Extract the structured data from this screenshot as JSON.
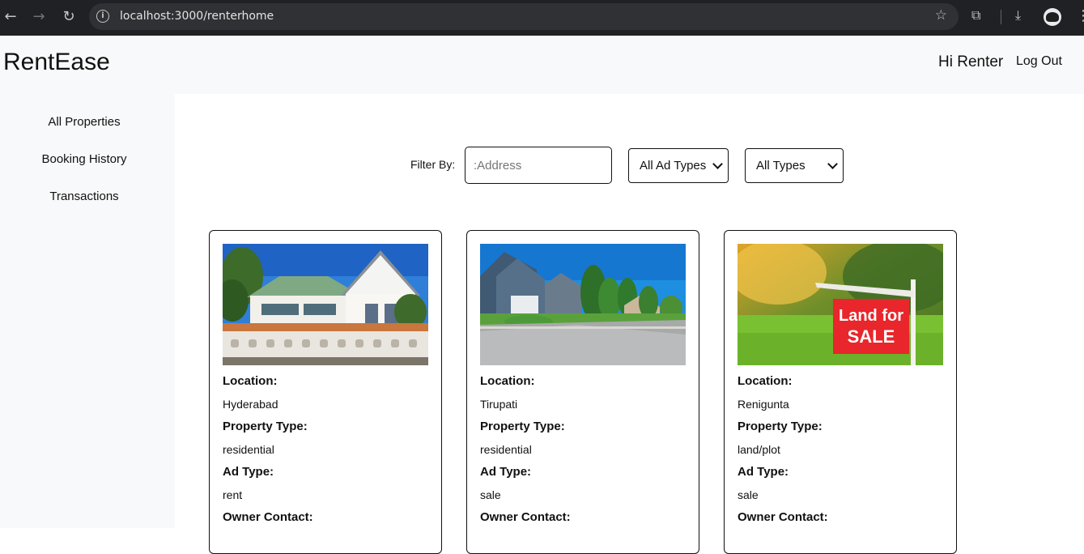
{
  "browser": {
    "url": "localhost:3000/renterhome",
    "back_icon": "back-arrow-icon",
    "forward_icon": "forward-arrow-icon",
    "reload_icon": "reload-icon"
  },
  "header": {
    "brand": "RentEase",
    "greeting": "Hi Renter",
    "logout": "Log Out"
  },
  "sidebar": {
    "items": [
      {
        "label": "All Properties"
      },
      {
        "label": "Booking History"
      },
      {
        "label": "Transactions"
      }
    ]
  },
  "filters": {
    "label": "Filter By:",
    "address_placeholder": ":Address",
    "ad_type_value": "All Ad Types",
    "type_value": "All Types"
  },
  "labels": {
    "location": "Location:",
    "property_type": "Property Type:",
    "ad_type": "Ad Type:",
    "owner_contact": "Owner Contact:"
  },
  "properties": [
    {
      "location": "Hyderabad",
      "property_type": "residential",
      "ad_type": "rent"
    },
    {
      "location": "Tirupati",
      "property_type": "residential",
      "ad_type": "sale"
    },
    {
      "location": "Renigunta",
      "property_type": "land/plot",
      "ad_type": "sale",
      "sign_line1": "Land for",
      "sign_line2": "SALE"
    }
  ],
  "colors": {
    "sidebar_bg": "#f8f9fa",
    "border": "#111111",
    "sign_red": "#e8262b"
  }
}
